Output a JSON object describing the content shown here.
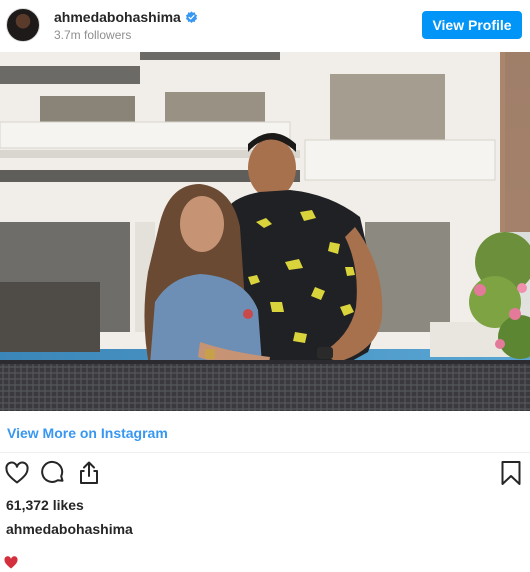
{
  "header": {
    "username": "ahmedabohashima",
    "followers": "3.7m followers",
    "view_profile_label": "View Profile",
    "verified_color": "#3897f0"
  },
  "photo": {
    "alt": "Photo by ahmedabohashima"
  },
  "footer": {
    "view_more_label": "View More on Instagram",
    "likes": "61,372 likes",
    "caption_user": "ahmedabohashima",
    "caption_emoji": "heart-emoji"
  },
  "colors": {
    "accent": "#0095f6",
    "link": "#3897f0",
    "heart": "#d32f3c"
  },
  "icons": [
    "verified-badge-icon",
    "heart-icon",
    "comment-icon",
    "share-icon",
    "bookmark-icon",
    "red-heart-icon"
  ]
}
